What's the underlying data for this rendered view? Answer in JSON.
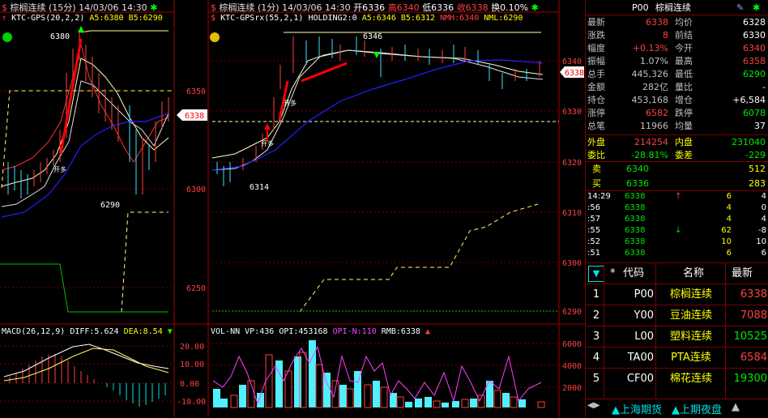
{
  "left_chart": {
    "title": "棕榈连续 (15分) 14/03/06 14:30",
    "indicator": "KTC-GPS(20,2,2)",
    "a5": "A5:6380",
    "b5": "B5:6290",
    "y_ticks": [
      "6350",
      "6300",
      "6250"
    ],
    "price_tag": "6338",
    "ann_high": "6380",
    "ann_low": "6290",
    "kaiduo": "开多"
  },
  "center_chart": {
    "title": "棕榈连续 (1分) 14/03/06 14:30",
    "open": "开6336",
    "high": "高6340",
    "low": "低6336",
    "close": "收6338",
    "turnover": "换0.10%",
    "indicator": "KTC-GPSrx(55,2,1)",
    "holding": "HOLDING2:0",
    "a5": "A5:6346",
    "b5": "B5:6312",
    "nmh": "NMH:6340",
    "nml": "NML:6290",
    "y_ticks": [
      "6340",
      "6330",
      "6320",
      "6310",
      "6300",
      "6290"
    ],
    "price_tag": "6338",
    "ann_top": "6346",
    "ann_low": "6314",
    "kaiduo": "开多"
  },
  "macd": {
    "label": "MACD(26,12,9)",
    "diff": "DIFF:5.624",
    "dea": "DEA:8.54",
    "y_ticks": [
      "20.00",
      "10.00",
      "0.00",
      "-10.00"
    ]
  },
  "volume": {
    "label": "VOL-NN",
    "vp": "VP:436",
    "opi": "OPI:453168",
    "opin": "OPI-N:110",
    "rmb": "RMB:6338",
    "y_ticks": [
      "6000",
      "4000",
      "2000"
    ]
  },
  "quote": {
    "code": "P00",
    "name": "棕榈连续",
    "rows": [
      {
        "l1": "最新",
        "v1": "6338",
        "c1": "red",
        "l2": "均价",
        "v2": "6328",
        "c2": "lab"
      },
      {
        "l1": "涨跌",
        "v1": "8",
        "c1": "red",
        "l2": "前结",
        "v2": "6330",
        "c2": "lab"
      },
      {
        "l1": "幅度",
        "v1": "+0.13%",
        "c1": "red",
        "l2": "今开",
        "v2": "6340",
        "c2": "red"
      },
      {
        "l1": "振幅",
        "v1": "1.07%",
        "c1": "lab",
        "l2": "最高",
        "v2": "6358",
        "c2": "red"
      },
      {
        "l1": "总手",
        "v1": "445,326",
        "c1": "lab",
        "l2": "最低",
        "v2": "6290",
        "c2": "green"
      },
      {
        "l1": "金额",
        "v1": "282亿",
        "c1": "lab",
        "l2": "量比",
        "v2": "-",
        "c2": "lab"
      },
      {
        "l1": "持仓",
        "v1": "453,168",
        "c1": "lab",
        "l2": "增仓",
        "v2": "+6,584",
        "c2": "lab"
      },
      {
        "l1": "涨停",
        "v1": "6582",
        "c1": "red",
        "l2": "跌停",
        "v2": "6078",
        "c2": "green"
      },
      {
        "l1": "总笔",
        "v1": "11966",
        "c1": "lab",
        "l2": "均量",
        "v2": "37",
        "c2": "lab"
      }
    ],
    "outer_label": "外盘",
    "outer_value": "214254",
    "inner_label": "内盘",
    "inner_value": "231040",
    "ratio_label": "委比",
    "ratio_value": "-28.81%",
    "diff_label": "委差",
    "diff_value": "-229",
    "sell_label": "卖",
    "sell_price": "6340",
    "sell_vol": "512",
    "buy_label": "买",
    "buy_price": "6336",
    "buy_vol": "283"
  },
  "ticks": [
    {
      "t": "14:29",
      "p": "6338",
      "a": "↑",
      "ac": "red",
      "v": "6",
      "c": "4",
      "cc": "lab"
    },
    {
      "t": ":56",
      "p": "6338",
      "a": "",
      "ac": "lab",
      "v": "4",
      "c": "0",
      "cc": "lab"
    },
    {
      "t": ":57",
      "p": "6338",
      "a": "",
      "ac": "lab",
      "v": "4",
      "c": "4",
      "cc": "lab"
    },
    {
      "t": ":55",
      "p": "6338",
      "a": "↓",
      "ac": "green",
      "v": "62",
      "c": "-8",
      "cc": "lab"
    },
    {
      "t": ":52",
      "p": "6338",
      "a": "",
      "ac": "lab",
      "v": "10",
      "c": "10",
      "cc": "lab"
    },
    {
      "t": ":51",
      "p": "6338",
      "a": "",
      "ac": "lab",
      "v": "6",
      "c": "6",
      "cc": "lab"
    }
  ],
  "watchlist": {
    "headers": [
      "*",
      "代码",
      "名称",
      "最新"
    ],
    "rows": [
      {
        "n": "1",
        "code": "P00",
        "name": "棕榈连续",
        "price": "6338",
        "pc": "red"
      },
      {
        "n": "2",
        "code": "Y00",
        "name": "豆油连续",
        "price": "7088",
        "pc": "red"
      },
      {
        "n": "3",
        "code": "L00",
        "name": "塑料连续",
        "price": "10525",
        "pc": "green"
      },
      {
        "n": "4",
        "code": "TA00",
        "name": "PTA连续",
        "price": "6584",
        "pc": "red"
      },
      {
        "n": "5",
        "code": "CF00",
        "name": "棉花连续",
        "price": "19300",
        "pc": "green"
      }
    ]
  },
  "tabs": [
    "上海期货",
    "上期夜盘"
  ]
}
